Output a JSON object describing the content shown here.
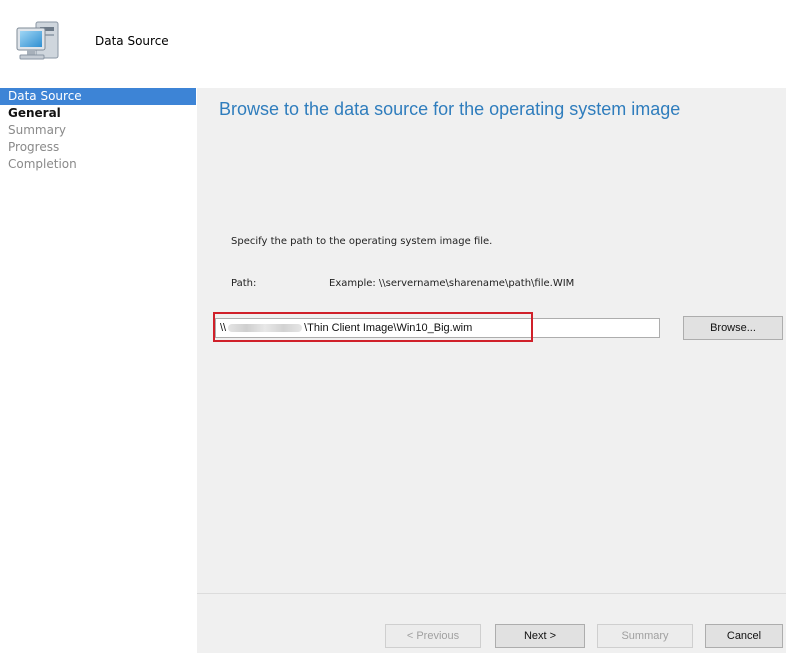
{
  "header": {
    "title": "Data Source"
  },
  "nav": {
    "items": [
      {
        "label": "Data Source"
      },
      {
        "label": "General"
      },
      {
        "label": "Summary"
      },
      {
        "label": "Progress"
      },
      {
        "label": "Completion"
      }
    ]
  },
  "main": {
    "heading": "Browse to the data source for the operating system image",
    "instructions": "Specify the path to the operating system image file.",
    "path_label": "Path:",
    "example": "Example: \\\\servername\\sharename\\path\\file.WIM",
    "path_prefix": "\\\\",
    "path_suffix": "\\Thin Client Image\\Win10_Big.wim",
    "browse_label": "Browse..."
  },
  "footer": {
    "previous_label": "< Previous",
    "next_label": "Next >",
    "summary_label": "Summary",
    "cancel_label": "Cancel"
  },
  "colors": {
    "accent": "#3d84d6",
    "heading": "#2f7dbd",
    "highlight": "#d0202a"
  }
}
